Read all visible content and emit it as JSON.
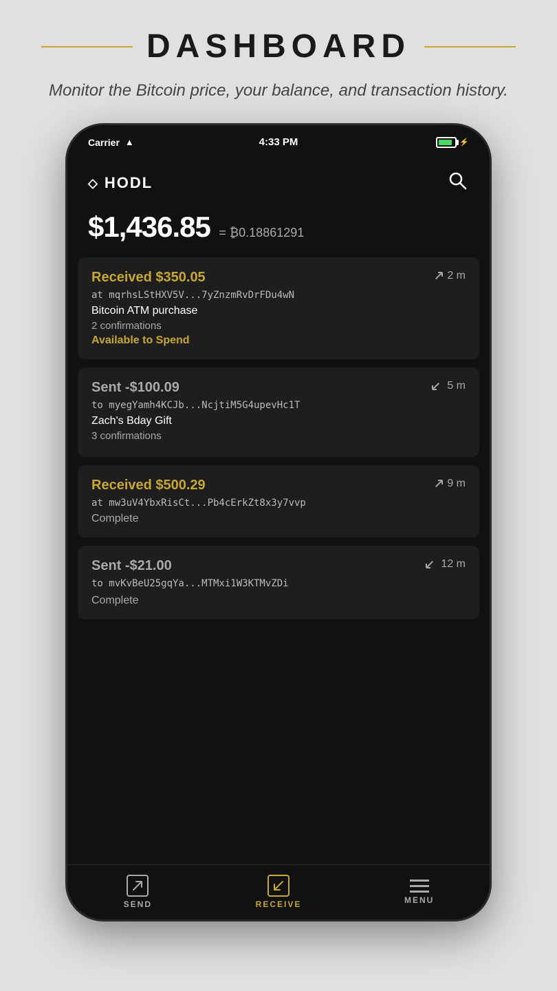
{
  "header": {
    "title": "DASHBOARD",
    "subtitle": "Monitor the Bitcoin price, your balance, and transaction history."
  },
  "status_bar": {
    "carrier": "Carrier",
    "time": "4:33 PM"
  },
  "app": {
    "logo_text": "HODL",
    "balance_usd": "$1,436.85",
    "balance_btc_prefix": "= ₿",
    "balance_btc": "0.18861291"
  },
  "transactions": [
    {
      "amount": "Received $350.05",
      "type": "received",
      "time": "2 m",
      "address": "at mqrhsLStHXV5V...7yZnzmRvDrFDu4wN",
      "label": "Bitcoin ATM purchase",
      "confirmations": "2 confirmations",
      "status": "Available to Spend",
      "status_type": "available"
    },
    {
      "amount": "Sent -$100.09",
      "type": "sent",
      "time": "5 m",
      "address": "to myegYamh4KCJb...NcjtiM5G4upevHc1T",
      "label": "Zach's Bday Gift",
      "confirmations": "3 confirmations",
      "status": "",
      "status_type": "none"
    },
    {
      "amount": "Received $500.29",
      "type": "received",
      "time": "9 m",
      "address": "at mw3uV4YbxRisCt...Pb4cErkZt8x3y7vvp",
      "label": "",
      "confirmations": "",
      "status": "Complete",
      "status_type": "complete"
    },
    {
      "amount": "Sent -$21.00",
      "type": "sent",
      "time": "12 m",
      "address": "to mvKvBeU25gqYa...MTMxi1W3KTMvZDi",
      "label": "",
      "confirmations": "",
      "status": "Complete",
      "status_type": "complete"
    }
  ],
  "nav": {
    "send_label": "SEND",
    "receive_label": "RECEIVE",
    "menu_label": "MENU"
  }
}
